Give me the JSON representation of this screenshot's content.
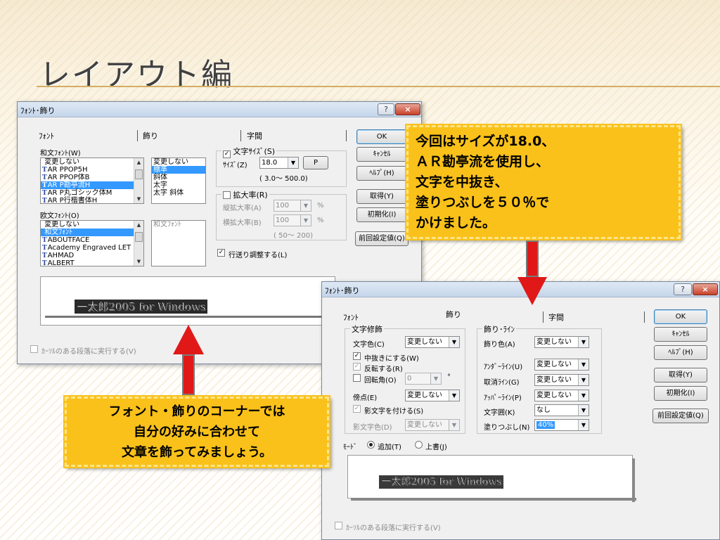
{
  "slide": {
    "title": "レイアウト編"
  },
  "colors": {
    "accent": "#d4ad62",
    "callout": "#f9c11a",
    "arrow": "#e01818",
    "selection": "#3399ff"
  },
  "dialog_left": {
    "title": "ﾌｫﾝﾄ･飾り",
    "help_btn": "?",
    "close_btn": "×",
    "tabs": [
      "ﾌｫﾝﾄ",
      "飾り",
      "字間"
    ],
    "buttons": {
      "ok": "OK",
      "cancel": "ｷｬﾝｾﾙ",
      "help": "ﾍﾙﾌﾟ(H)",
      "get": "取得(Y)",
      "init": "初期化(I)",
      "prev": "前回設定値(Q)"
    },
    "jp_font_label": "和文ﾌｫﾝﾄ(W)",
    "jp_fonts": [
      "変更しない",
      "AR PPOP5H",
      "AR PPOP体B",
      "AR P勘亭流H",
      "AR P丸ゴシック体M",
      "AR P行楷書体H"
    ],
    "style_list": [
      "変更しない",
      "標準",
      "斜体",
      "太字",
      "太字 斜体"
    ],
    "en_font_label": "欧文ﾌｫﾝﾄ(O)",
    "en_fonts": [
      "変更しない",
      "和文ﾌｫﾝﾄ",
      "ABOUTFACE",
      "Academy Engraved LET",
      "AHMAD",
      "ALBERT"
    ],
    "en_style_placeholder": "和文ﾌｫﾝﾄ",
    "size_group": "文字ｻｲｽﾞ(S)",
    "size_label": "ｻｲｽﾞ(Z)",
    "size_value": "18.0",
    "p_button": "P",
    "size_range": "( 3.0～ 500.0)",
    "scale_group": "拡大率(R)",
    "h_scale_label": "縦拡大率(A)",
    "h_scale_value": "100",
    "w_scale_label": "横拡大率(B)",
    "w_scale_value": "100",
    "pct": "%",
    "scale_range": "( 50～ 200)",
    "line_adjust": "行送り調整する(L)",
    "preview_text": "一太郎2005 for Windows",
    "cursor_apply": "ｶｰｿﾙのある段落に実行する(V)"
  },
  "dialog_right": {
    "title": "ﾌｫﾝﾄ･飾り",
    "help_btn": "?",
    "close_btn": "×",
    "tabs": [
      "ﾌｫﾝﾄ",
      "飾り",
      "字間"
    ],
    "buttons": {
      "ok": "OK",
      "cancel": "ｷｬﾝｾﾙ",
      "help": "ﾍﾙﾌﾟ(H)",
      "get": "取得(Y)",
      "init": "初期化(I)",
      "prev": "前回設定値(Q)"
    },
    "char_group": "文字修飾",
    "text_color_label": "文字色(C)",
    "text_color_value": "変更しない",
    "hollow": "中抜きにする(W)",
    "invert": "反転する(R)",
    "rotate": "回転角(O)",
    "rotate_value": "0",
    "degree": "°",
    "emphasis_label": "傍点(E)",
    "emphasis_value": "変更しない",
    "shadow": "影文字を付ける(S)",
    "shadow_color_label": "影文字色(D)",
    "shadow_color_value": "変更しない",
    "line_group": "飾り･ﾗｲﾝ",
    "deco_color_label": "飾り色(A)",
    "deco_color_value": "変更しない",
    "underline_label": "ｱﾝﾀﾞｰﾗｲﾝ(U)",
    "underline_value": "変更しない",
    "strike_label": "取消ﾗｲﾝ(G)",
    "strike_value": "変更しない",
    "upper_label": "ｱｯﾊﾟｰﾗｲﾝ(P)",
    "upper_value": "変更しない",
    "border_label": "文字囲(K)",
    "border_value": "なし",
    "fill_label": "塗りつぶし(N)",
    "fill_value": "40%",
    "mode_label": "ﾓｰﾄﾞ",
    "mode_add": "追加(T)",
    "mode_overwrite": "上書(J)",
    "preview_text": "一太郎2005 for Windows",
    "cursor_apply": "ｶｰｿﾙのある段落に実行する(V)"
  },
  "callout_right": {
    "lines": [
      "今回はサイズが18.0、",
      "ＡＲ勘亭流を使用し、",
      "文字を中抜き、",
      "塗りつぶしを５０％で",
      "かけました。"
    ]
  },
  "callout_left": {
    "lines": [
      "フォント・飾りのコーナーでは",
      "自分の好みに合わせて",
      "文章を飾ってみましょう。"
    ]
  }
}
